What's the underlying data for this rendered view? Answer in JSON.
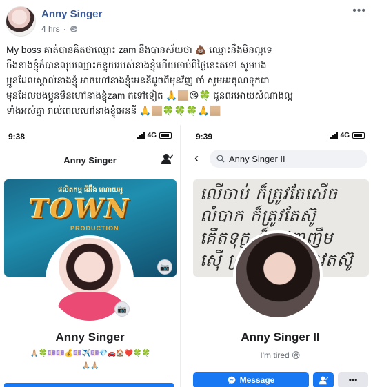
{
  "post": {
    "author": "Anny Singer",
    "time": "4 hrs",
    "more": "•••",
    "lines": [
      "My boss គាត់បានគិតថាឈ្មោះ zam នឹងបានស័យថា 💩 ឈ្មោះនឹងមិនល្អទេ",
      "ចឹងនាងខ្ញុំក៏បានលុបឈ្មោះកន្ទុយរបស់នាងខ្ញុំហើយចាប់ពីថ្ងៃនេះតទៅ សូមបង",
      "ប្អូនដែលស្គាល់នាងខ្ញុំ អាចហៅនាងខ្ញុំអេននីដូចពីមុនវិញ ចាំ សូមអរគុណទុកជា",
      "មុនដែលបងប្អូនមិនហៅនាងខ្ញុំzam តទៅទៀត 🙏🏼😘🍀 ជូនពរអោយសំណាងល្អ",
      "ទាំងអស់គ្នា រាល់ពេលហៅនាងខ្ញុំអេននី 🙏🏼🍀🍀🍀🙏🏼"
    ]
  },
  "left_phone": {
    "time": "9:38",
    "network": "4G",
    "nav_title": "Anny Singer",
    "cover_subtitle": "ផលិតកម្ម ធីអ៊ឹង ណោយអូ",
    "cover_logo": "TOWN",
    "cover_tag": "PRODUCTION",
    "profile_name": "Anny Singer",
    "emoji_line_1": "🙏🏼🍀💷💷💰💷✈️💷💎🚗🏠❤️🍀🍀",
    "emoji_line_2": "🙏🏼🙏🏼"
  },
  "right_phone": {
    "time": "9:39",
    "network": "4G",
    "search_value": "Anny Singer II",
    "cover_lines": [
      "លើចាប់ ក៏ត្រូវតែសើច",
      "លំបាក ក៏ត្រូវតែស៊ូ",
      "គើតទុក្ខ ក៏ត្រូវញញឹម",
      "ស៊ើ ស្រឡាញ់ ក៏ត្រូវតស៊ូ"
    ],
    "profile_name": "Anny Singer II",
    "bio": "I'm tired 😪",
    "message_button": "Message",
    "more_button": "•••"
  }
}
